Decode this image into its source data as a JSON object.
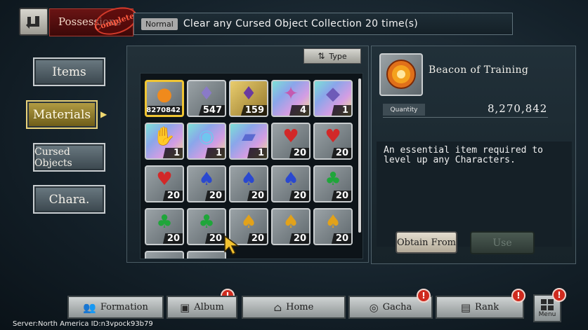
{
  "header": {
    "title": "Possessions",
    "stamp": "Complete!",
    "mission": {
      "difficulty": "Normal",
      "text": "Clear any Cursed Object Collection 20 time(s)"
    }
  },
  "sidebar": {
    "tabs": [
      {
        "label": "Items",
        "active": false
      },
      {
        "label": "Materials",
        "active": true
      },
      {
        "label": "Cursed Objects",
        "active": false
      },
      {
        "label": "Chara.",
        "active": false
      }
    ]
  },
  "grid": {
    "sort_label": "Type",
    "items": [
      {
        "name": "Beacon of Training",
        "icon": "flame-orb-icon",
        "count": "8270842",
        "rarity": "gray",
        "selected": true
      },
      {
        "name": "",
        "icon": "purple-crystal-icon",
        "count": "547",
        "rarity": "gray"
      },
      {
        "name": "",
        "icon": "violet-crystal-icon",
        "count": "159",
        "rarity": "gold"
      },
      {
        "name": "",
        "icon": "pink-crystal-icon",
        "count": "4",
        "rarity": "rainbow"
      },
      {
        "name": "",
        "icon": "shard-icon",
        "count": "1",
        "rarity": "rainbow"
      },
      {
        "name": "",
        "icon": "hand-crystal-icon",
        "count": "1",
        "rarity": "rainbow"
      },
      {
        "name": "",
        "icon": "crystal-ball-icon",
        "count": "1",
        "rarity": "rainbow"
      },
      {
        "name": "",
        "icon": "book-icon",
        "count": "1",
        "rarity": "rainbow"
      },
      {
        "name": "",
        "icon": "red-flame-icon",
        "count": "20",
        "rarity": "gray"
      },
      {
        "name": "",
        "icon": "red-flame-icon",
        "count": "20",
        "rarity": "gray"
      },
      {
        "name": "",
        "icon": "red-flame-icon",
        "count": "20",
        "rarity": "gray"
      },
      {
        "name": "",
        "icon": "blue-flame-icon",
        "count": "20",
        "rarity": "gray"
      },
      {
        "name": "",
        "icon": "blue-flame-icon",
        "count": "20",
        "rarity": "gray"
      },
      {
        "name": "",
        "icon": "blue-flame-icon",
        "count": "20",
        "rarity": "gray"
      },
      {
        "name": "",
        "icon": "green-flame-icon",
        "count": "20",
        "rarity": "gray"
      },
      {
        "name": "",
        "icon": "green-flame-icon",
        "count": "20",
        "rarity": "gray"
      },
      {
        "name": "",
        "icon": "green-flame-icon",
        "count": "20",
        "rarity": "gray"
      },
      {
        "name": "",
        "icon": "yellow-flame-icon",
        "count": "20",
        "rarity": "gray"
      },
      {
        "name": "",
        "icon": "yellow-flame-icon",
        "count": "20",
        "rarity": "gray"
      },
      {
        "name": "",
        "icon": "yellow-flame-icon",
        "count": "20",
        "rarity": "gray"
      }
    ]
  },
  "detail": {
    "name": "Beacon of Training",
    "icon": "flame-orb-icon",
    "quantity_label": "Quantity",
    "quantity": "8,270,842",
    "description": "An essential item required to level up any Characters.",
    "obtain_label": "Obtain From",
    "use_label": "Use"
  },
  "nav": {
    "items": [
      {
        "label": "Formation",
        "icon": "people-icon",
        "badge": true
      },
      {
        "label": "Album",
        "icon": "picture-icon",
        "badge": false
      },
      {
        "label": "Home",
        "icon": "house-icon",
        "badge": false
      },
      {
        "label": "Gacha",
        "icon": "swirl-icon",
        "badge": true
      },
      {
        "label": "Rank",
        "icon": "ticket-icon",
        "badge": true
      }
    ],
    "menu_label": "Menu",
    "badge_symbol": "!"
  },
  "footer": {
    "server": "Server:North America ID:n3vpock93b79"
  },
  "colors": {
    "accent_gold": "#f0c533",
    "badge_red": "#cf2a1e"
  }
}
